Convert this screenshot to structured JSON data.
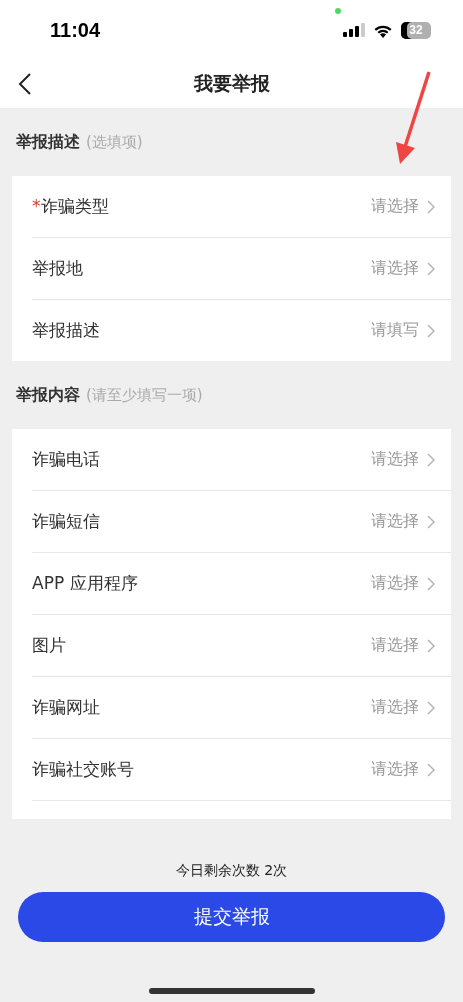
{
  "status_bar": {
    "time": "11:04",
    "battery": "32"
  },
  "header": {
    "title": "我要举报"
  },
  "sections": [
    {
      "title": "举报描述",
      "hint": "(选填项)",
      "rows": [
        {
          "marker": "*",
          "label": "诈骗类型",
          "value": "请选择"
        },
        {
          "label": "举报地",
          "value": "请选择"
        },
        {
          "label": "举报描述",
          "value": "请填写"
        }
      ]
    },
    {
      "title": "举报内容",
      "hint": "(请至少填写一项)",
      "trailing_divider": true,
      "rows": [
        {
          "label": "诈骗电话",
          "value": "请选择"
        },
        {
          "label": "诈骗短信",
          "value": "请选择"
        },
        {
          "label": "APP 应用程序",
          "value": "请选择"
        },
        {
          "label": "图片",
          "value": "请选择"
        },
        {
          "label": "诈骗网址",
          "value": "请选择"
        },
        {
          "label": "诈骗社交账号",
          "value": "请选择"
        }
      ]
    }
  ],
  "footer": {
    "note": "今日剩余次数 2次",
    "submit": "提交举报"
  }
}
